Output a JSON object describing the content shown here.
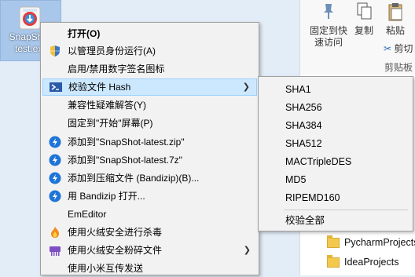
{
  "desktop_icon": {
    "label_line1": "SnapShot-",
    "label_line2": "test.exe"
  },
  "ribbon": {
    "pin_label_1": "固定到快",
    "pin_label_2": "速访问",
    "copy_label": "复制",
    "paste_label": "粘贴",
    "cut_label": "剪切",
    "group_label": "剪贴板"
  },
  "explorer": {
    "folders": [
      "PycharmProjects",
      "IdeaProjects"
    ]
  },
  "context_menu": {
    "items": [
      {
        "label": "打开(O)",
        "icon": "",
        "bold": true,
        "submenu": false
      },
      {
        "label": "以管理员身份运行(A)",
        "icon": "shield-icon",
        "submenu": false
      },
      {
        "label": "启用/禁用数字签名图标",
        "icon": "",
        "submenu": false
      },
      {
        "label": "校验文件 Hash",
        "icon": "powershell-icon",
        "submenu": true,
        "highlighted": true
      },
      {
        "label": "兼容性疑难解答(Y)",
        "icon": "",
        "submenu": false
      },
      {
        "label": "固定到\"开始\"屏幕(P)",
        "icon": "",
        "submenu": false
      },
      {
        "label": "添加到\"SnapShot-latest.zip\"",
        "icon": "bandizip-icon",
        "submenu": false
      },
      {
        "label": "添加到\"SnapShot-latest.7z\"",
        "icon": "bandizip-icon",
        "submenu": false
      },
      {
        "label": "添加到压缩文件 (Bandizip)(B)...",
        "icon": "bandizip-icon",
        "submenu": false
      },
      {
        "label": "用 Bandizip 打开...",
        "icon": "bandizip-icon",
        "submenu": false
      },
      {
        "label": "EmEditor",
        "icon": "",
        "submenu": false
      },
      {
        "label": "使用火绒安全进行杀毒",
        "icon": "huorong-flame-icon",
        "submenu": false
      },
      {
        "label": "使用火绒安全粉碎文件",
        "icon": "shredder-icon",
        "submenu": true
      },
      {
        "label": "使用小米互传发送",
        "icon": "",
        "submenu": false
      }
    ]
  },
  "hash_submenu": {
    "items": [
      "SHA1",
      "SHA256",
      "SHA384",
      "SHA512",
      "MACTripleDES",
      "MD5",
      "RIPEMD160"
    ],
    "verify_all": "校验全部"
  },
  "colors": {
    "menu_bg": "#f2f2f2",
    "highlight": "#cce8ff",
    "desktop_bg": "#e3edf8",
    "bandizip_blue": "#1e74d8"
  }
}
